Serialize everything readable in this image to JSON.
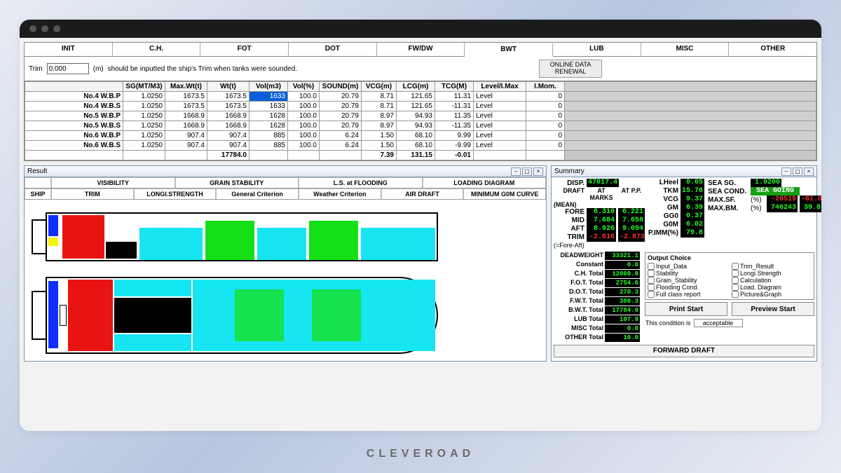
{
  "branding": "CLEVEROAD",
  "tabs": [
    "INIT",
    "C.H.",
    "FOT",
    "DOT",
    "FW/DW",
    "BWT",
    "LUB",
    "MISC",
    "OTHER"
  ],
  "activeTab": "BWT",
  "trim": {
    "label": "Trim",
    "value": "0.000",
    "unit": "(m)",
    "hint": "should be inputted the ship's Trim when tanks were sounded."
  },
  "renewal": "ONLINE DATA RENEWAL",
  "columns": [
    "",
    "SG(MT/M3)",
    "Max.Wt(t)",
    "Wt(t)",
    "Vol(m3)",
    "Vol(%)",
    "SOUND(m)",
    "VCG(m)",
    "LCG(m)",
    "TCG(M)",
    "Level/I.Max",
    "I.Mom."
  ],
  "rows": [
    {
      "name": "No.4 W.B.P",
      "sg": "1.0250",
      "max": "1673.5",
      "wt": "1673.5",
      "vol": "1633",
      "volp": "100.0",
      "sound": "20.79",
      "vcg": "8.71",
      "lcg": "121.65",
      "tcg": "11.31",
      "level": "Level",
      "imom": "0",
      "sel": true
    },
    {
      "name": "No.4 W.B.S",
      "sg": "1.0250",
      "max": "1673.5",
      "wt": "1673.5",
      "vol": "1633",
      "volp": "100.0",
      "sound": "20.79",
      "vcg": "8.71",
      "lcg": "121.65",
      "tcg": "-11.31",
      "level": "Level",
      "imom": "0"
    },
    {
      "name": "No.5 W.B.P",
      "sg": "1.0250",
      "max": "1668.9",
      "wt": "1668.9",
      "vol": "1628",
      "volp": "100.0",
      "sound": "20.79",
      "vcg": "8.97",
      "lcg": "94.93",
      "tcg": "11.35",
      "level": "Level",
      "imom": "0"
    },
    {
      "name": "No.5 W.B.S",
      "sg": "1.0250",
      "max": "1668.9",
      "wt": "1668.9",
      "vol": "1628",
      "volp": "100.0",
      "sound": "20.79",
      "vcg": "8.97",
      "lcg": "94.93",
      "tcg": "-11.35",
      "level": "Level",
      "imom": "0"
    },
    {
      "name": "No.6 W.B.P",
      "sg": "1.0250",
      "max": "907.4",
      "wt": "907.4",
      "vol": "885",
      "volp": "100.0",
      "sound": "6.24",
      "vcg": "1.50",
      "lcg": "68.10",
      "tcg": "9.99",
      "level": "Level",
      "imom": "0"
    },
    {
      "name": "No.6 W.B.S",
      "sg": "1.0250",
      "max": "907.4",
      "wt": "907.4",
      "vol": "885",
      "volp": "100.0",
      "sound": "6.24",
      "vcg": "1.50",
      "lcg": "68.10",
      "tcg": "-9.99",
      "level": "Level",
      "imom": "0"
    }
  ],
  "totals": {
    "wt": "17784.0",
    "vcg": "7.39",
    "lcg": "131.15",
    "tcg": "-0.01"
  },
  "result": {
    "title": "Result",
    "shipLabel": "SHIP",
    "subtabs_row1": [
      "VISIBILITY",
      "GRAIN STABILITY",
      "L.S. at FLOODING",
      "LOADING DIAGRAM"
    ],
    "subtabs_row2": [
      "TRIM",
      "LONGI.STRENGTH",
      "General Criterion",
      "Weather Criterion",
      "AIR DRAFT",
      "MINIMUM G0M CURVE"
    ]
  },
  "summary": {
    "title": "Summary",
    "disp": {
      "label": "DISP.",
      "val": "47017.4"
    },
    "draftHead": {
      "l": "DRAFT",
      "c1": "AT MARKS",
      "c2": "AT P.P."
    },
    "mean": "(MEAN)",
    "drafts": [
      {
        "l": "FORE",
        "m": "6.310",
        "p": "6.221"
      },
      {
        "l": "MID",
        "m": "7.684",
        "p": "7.658"
      },
      {
        "l": "AFT",
        "m": "8.926",
        "p": "9.094"
      },
      {
        "l": "TRIM",
        "m": "-2.616",
        "p": "-2.873",
        "neg": true
      }
    ],
    "forenote": "(=Fore-Aft)",
    "right": [
      {
        "l": "LHeel",
        "v": "0.05"
      },
      {
        "l": "TKM",
        "v": "15.76"
      },
      {
        "l": "VCG",
        "v": "9.37"
      },
      {
        "l": "GM",
        "v": "6.39"
      },
      {
        "l": "GG0",
        "v": "0.37"
      },
      {
        "l": "G0M",
        "v": "6.02"
      },
      {
        "l": "P.IMM(%)",
        "v": "79.8"
      }
    ],
    "far": [
      {
        "l": "SEA SG.",
        "v": "1.0200"
      },
      {
        "l": "SEA COND.",
        "v": "SEA GOING",
        "big": true
      },
      {
        "l": "MAX.SF.",
        "pct": "(%)",
        "v": "-26519",
        "v2": "-61.0",
        "neg": true
      },
      {
        "l": "MAX.BM.",
        "pct": "(%)",
        "v": "746243",
        "v2": "39.8"
      }
    ],
    "weights": [
      {
        "l": "DEADWEIGHT",
        "v": "33321.1"
      },
      {
        "l": "Constant",
        "v": "0.0"
      },
      {
        "l": "C.H. Total",
        "v": "12000.0"
      },
      {
        "l": "F.O.T. Total",
        "v": "2754.6"
      },
      {
        "l": "D.O.T. Total",
        "v": "278.3"
      },
      {
        "l": "F.W.T. Total",
        "v": "386.3"
      },
      {
        "l": "B.W.T. Total",
        "v": "17784.0"
      },
      {
        "l": "LUB Total",
        "v": "107.9"
      },
      {
        "l": "MISC Total",
        "v": "0.0"
      },
      {
        "l": "OTHER Total",
        "v": "10.0"
      }
    ],
    "output": {
      "title": "Output Choice",
      "items": [
        [
          "Input_Data",
          "Trim_Result"
        ],
        [
          "Stability",
          "Longi.Strength"
        ],
        [
          "Grain_Stability",
          "Calculation"
        ],
        [
          "Flooding Cond.",
          "Load. Diagram"
        ],
        [
          "Full class report",
          "Picture&Graph"
        ]
      ]
    },
    "print": "Print Start",
    "preview": "Preview Start",
    "condLabel": "This condition is",
    "condVal": "acceptable",
    "forward": "FORWARD DRAFT"
  }
}
